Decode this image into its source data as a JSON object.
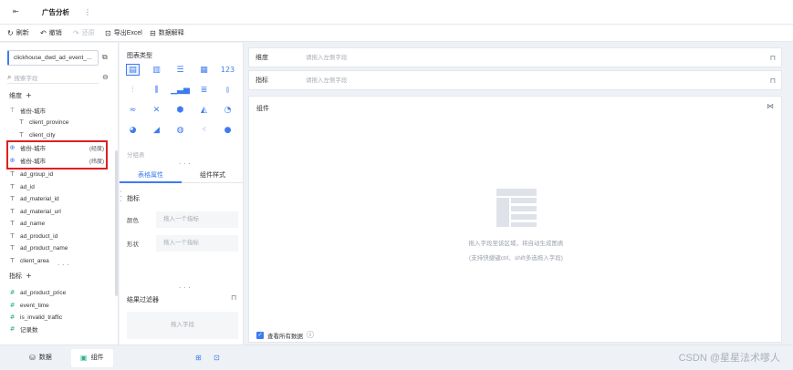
{
  "topbar": {
    "tab_title": "广告分析",
    "more": "⋮"
  },
  "toolbar": {
    "refresh": "刷新",
    "undo": "撤销",
    "redo": "还原",
    "export_excel": "导出Excel",
    "data_explain": "数据解释"
  },
  "left": {
    "dataset": "clickhouse_dwd_ad_event_...",
    "search_placeholder": "搜索字段",
    "dimension_title": "维度",
    "dimension_group": "省份-城市",
    "dimensions_nested": [
      "client_province",
      "client_city"
    ],
    "geo_fields": [
      {
        "label": "省份-城市",
        "tag": "(经度)"
      },
      {
        "label": "省份-城市",
        "tag": "(纬度)"
      }
    ],
    "dimensions": [
      "ad_group_id",
      "ad_id",
      "ad_material_id",
      "ad_material_url",
      "ad_name",
      "ad_product_id",
      "ad_product_name",
      "client_area"
    ],
    "measure_title": "指标",
    "measures": [
      "ad_product_price",
      "event_time",
      "is_invalid_traffic",
      "记录数"
    ]
  },
  "mid": {
    "chart_type_title": "图表类型",
    "group_title": "分组表",
    "tab_table_attr": "表格属性",
    "tab_component_style": "组件样式",
    "metric_title": "指标",
    "color_label": "颜色",
    "color_placeholder": "拖入一个指标",
    "shape_label": "形状",
    "shape_placeholder": "拖入一个指标",
    "filter_title": "结果过滤器",
    "filter_placeholder": "拖入字段"
  },
  "right": {
    "dim_label": "维度",
    "dim_placeholder": "请拖入左侧字段",
    "metric_label": "指标",
    "metric_placeholder": "请拖入左侧字段",
    "component_title": "组件",
    "empty_line1": "拖入字段至该区域，将自动生成图表",
    "empty_line2": "(支持快捷键ctrl、shift多选拖入字段)",
    "view_all_data": "查看所有数据"
  },
  "bottom": {
    "tab_data": "数据",
    "tab_component": "组件",
    "watermark": "CSDN @星星法术嗲人"
  },
  "colors": {
    "accent": "#3e7bf2",
    "highlight": "#e02020"
  }
}
